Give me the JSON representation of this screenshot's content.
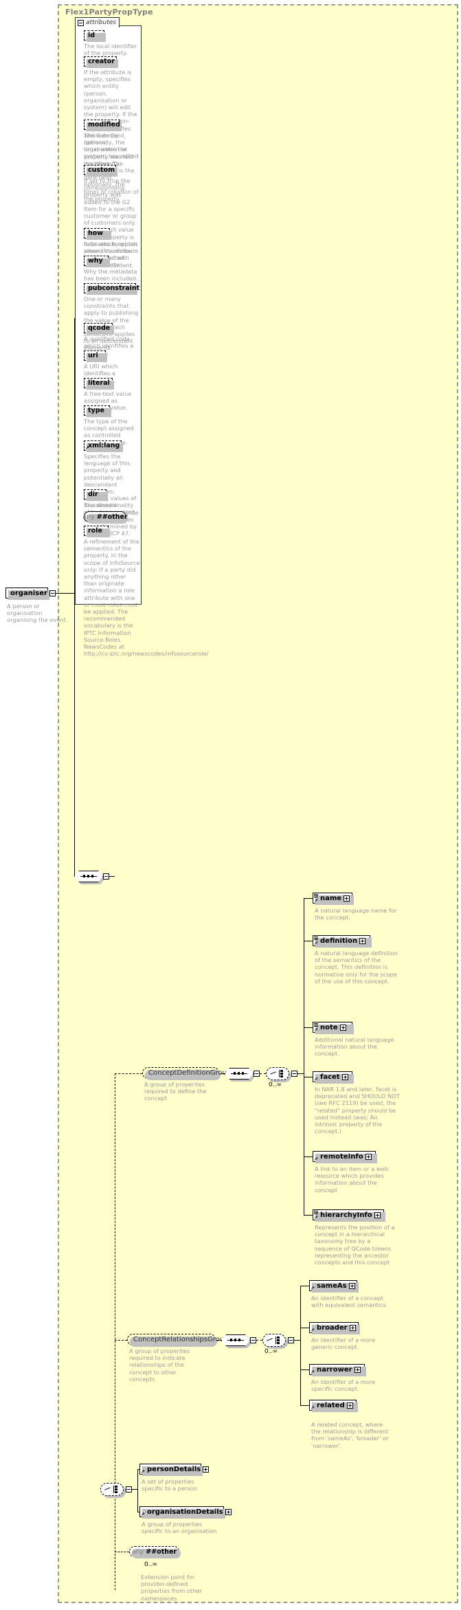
{
  "type_container": {
    "title": "Flex1PartyPropType",
    "bg_color": "#ffffcc",
    "border_color": "#999999"
  },
  "attributes_panel": {
    "tab_label": "attributes",
    "toggle": "minus-box",
    "items": [
      {
        "name": "id",
        "desc": "The local identifier of the property."
      },
      {
        "name": "creator",
        "desc": "If the attribute is empty, specifies which entity (person, organisation or system) will edit the property. If the attribute is non-empty, specifies which entity (person, organisation or system) has edited the property."
      },
      {
        "name": "modified",
        "desc": "The date (and, optionally, the time) when the property was last modified. The initial value is the date (and, optionally, the time) of creation of the property."
      },
      {
        "name": "custom",
        "desc": "If set to true the corresponding property was added to the G2 Item for a specific customer or group of customers only. The default value of this property is false which applies when this attribute is not used with the property."
      },
      {
        "name": "how",
        "desc": "Indicates by which means the value was extracted from the content."
      },
      {
        "name": "why",
        "desc": "Why the metadata has been included."
      },
      {
        "name": "pubconstraint",
        "desc": "One or many constraints that apply to publishing the value of the property. Each constraint applies to all descendant elements."
      },
      {
        "name": "qcode",
        "desc": "A qualified code which idenfifies a concept."
      },
      {
        "name": "uri",
        "desc": "A URI which identifies a concept."
      },
      {
        "name": "literal",
        "desc": "A free-text value assigned as property value."
      },
      {
        "name": "type",
        "desc": "The type of the concept assigned as controlled property value."
      },
      {
        "name": "xml:lang",
        "desc": "Specifies the language of this property and potentially all descendant properties. xml:lang values of descendant properties override this value. Values are determined by Internet BCP 47."
      },
      {
        "name": "dir",
        "desc": "The directionality of textual content."
      }
    ],
    "any_attribute": {
      "prefix": "any",
      "namespace": "##other"
    },
    "role": {
      "name": "role",
      "desc": "A refinement of the semantics of the property. In the scope of infoSource only: If a party did anything other than originate information a role attribute with one or more roles must be applied. The recommended vocabulary is the IPTC Information Source Roles NewsCodes at http://cv.iptc.org/newscodes/infosourcerole/"
    }
  },
  "root_element": {
    "name": "organiser",
    "desc": "A person or organisation organising the event.",
    "toggle": "minus-box"
  },
  "groups": [
    {
      "id": "concept-definition-group",
      "name": "ConceptDefinitionGroup",
      "desc": "A group of properites required to define the concept",
      "occurrence": "0..∞",
      "children": [
        {
          "name": "name",
          "desc": "A natural language name for the concept.",
          "has_lines_icon": true
        },
        {
          "name": "definition",
          "desc": "A natural language definition of the semantics of the concept. This definition is normative only for the scope of the use of this concept.",
          "has_lines_icon": true
        },
        {
          "name": "note",
          "desc": "Additional natural language information about the concept.",
          "has_lines_icon": true
        },
        {
          "name": "facet",
          "desc": "In NAR 1.8 and later, facet is deprecated and SHOULD NOT (see RFC 2119) be used, the \"related\" property should be used instead (was: An intrinsic property of the concept.)",
          "has_lines_icon": false
        },
        {
          "name": "remoteInfo",
          "desc": "A link to an item or a web resource which provides information about the concept",
          "has_lines_icon": false
        },
        {
          "name": "hierarchyInfo",
          "desc": "Represents the position of a concept in a hierarchical taxonomy tree by a sequence of QCode tokens representing the ancestor concepts and this concept",
          "has_lines_icon": true
        }
      ]
    },
    {
      "id": "concept-relationships-group",
      "name": "ConceptRelationshipsGroup",
      "desc": "A group of properites required to indicate relationships of the concept to other concepts",
      "occurrence": "0..∞",
      "children": [
        {
          "name": "sameAs",
          "desc": "An identifier of a concept with equivalent semantics",
          "has_lines_icon": false
        },
        {
          "name": "broader",
          "desc": "An identifier of a more generic concept.",
          "has_lines_icon": false
        },
        {
          "name": "narrower",
          "desc": "An identifier of a more specific concept.",
          "has_lines_icon": false
        },
        {
          "name": "related",
          "desc": "A related concept, where the relationship is different from 'sameAs', 'broader' or 'narrower'.",
          "has_lines_icon": false
        }
      ]
    }
  ],
  "details_choice": {
    "children": [
      {
        "name": "personDetails",
        "desc": "A set of properties specific to a person",
        "has_lines_icon": false
      },
      {
        "name": "organisationDetails",
        "desc": "A group of properties specific to an organisation",
        "has_lines_icon": false
      }
    ]
  },
  "any_element": {
    "prefix": "any",
    "namespace": "##other",
    "occurrence": "0..∞",
    "desc": "Extension point for provider-defined properties from other namespaces"
  }
}
